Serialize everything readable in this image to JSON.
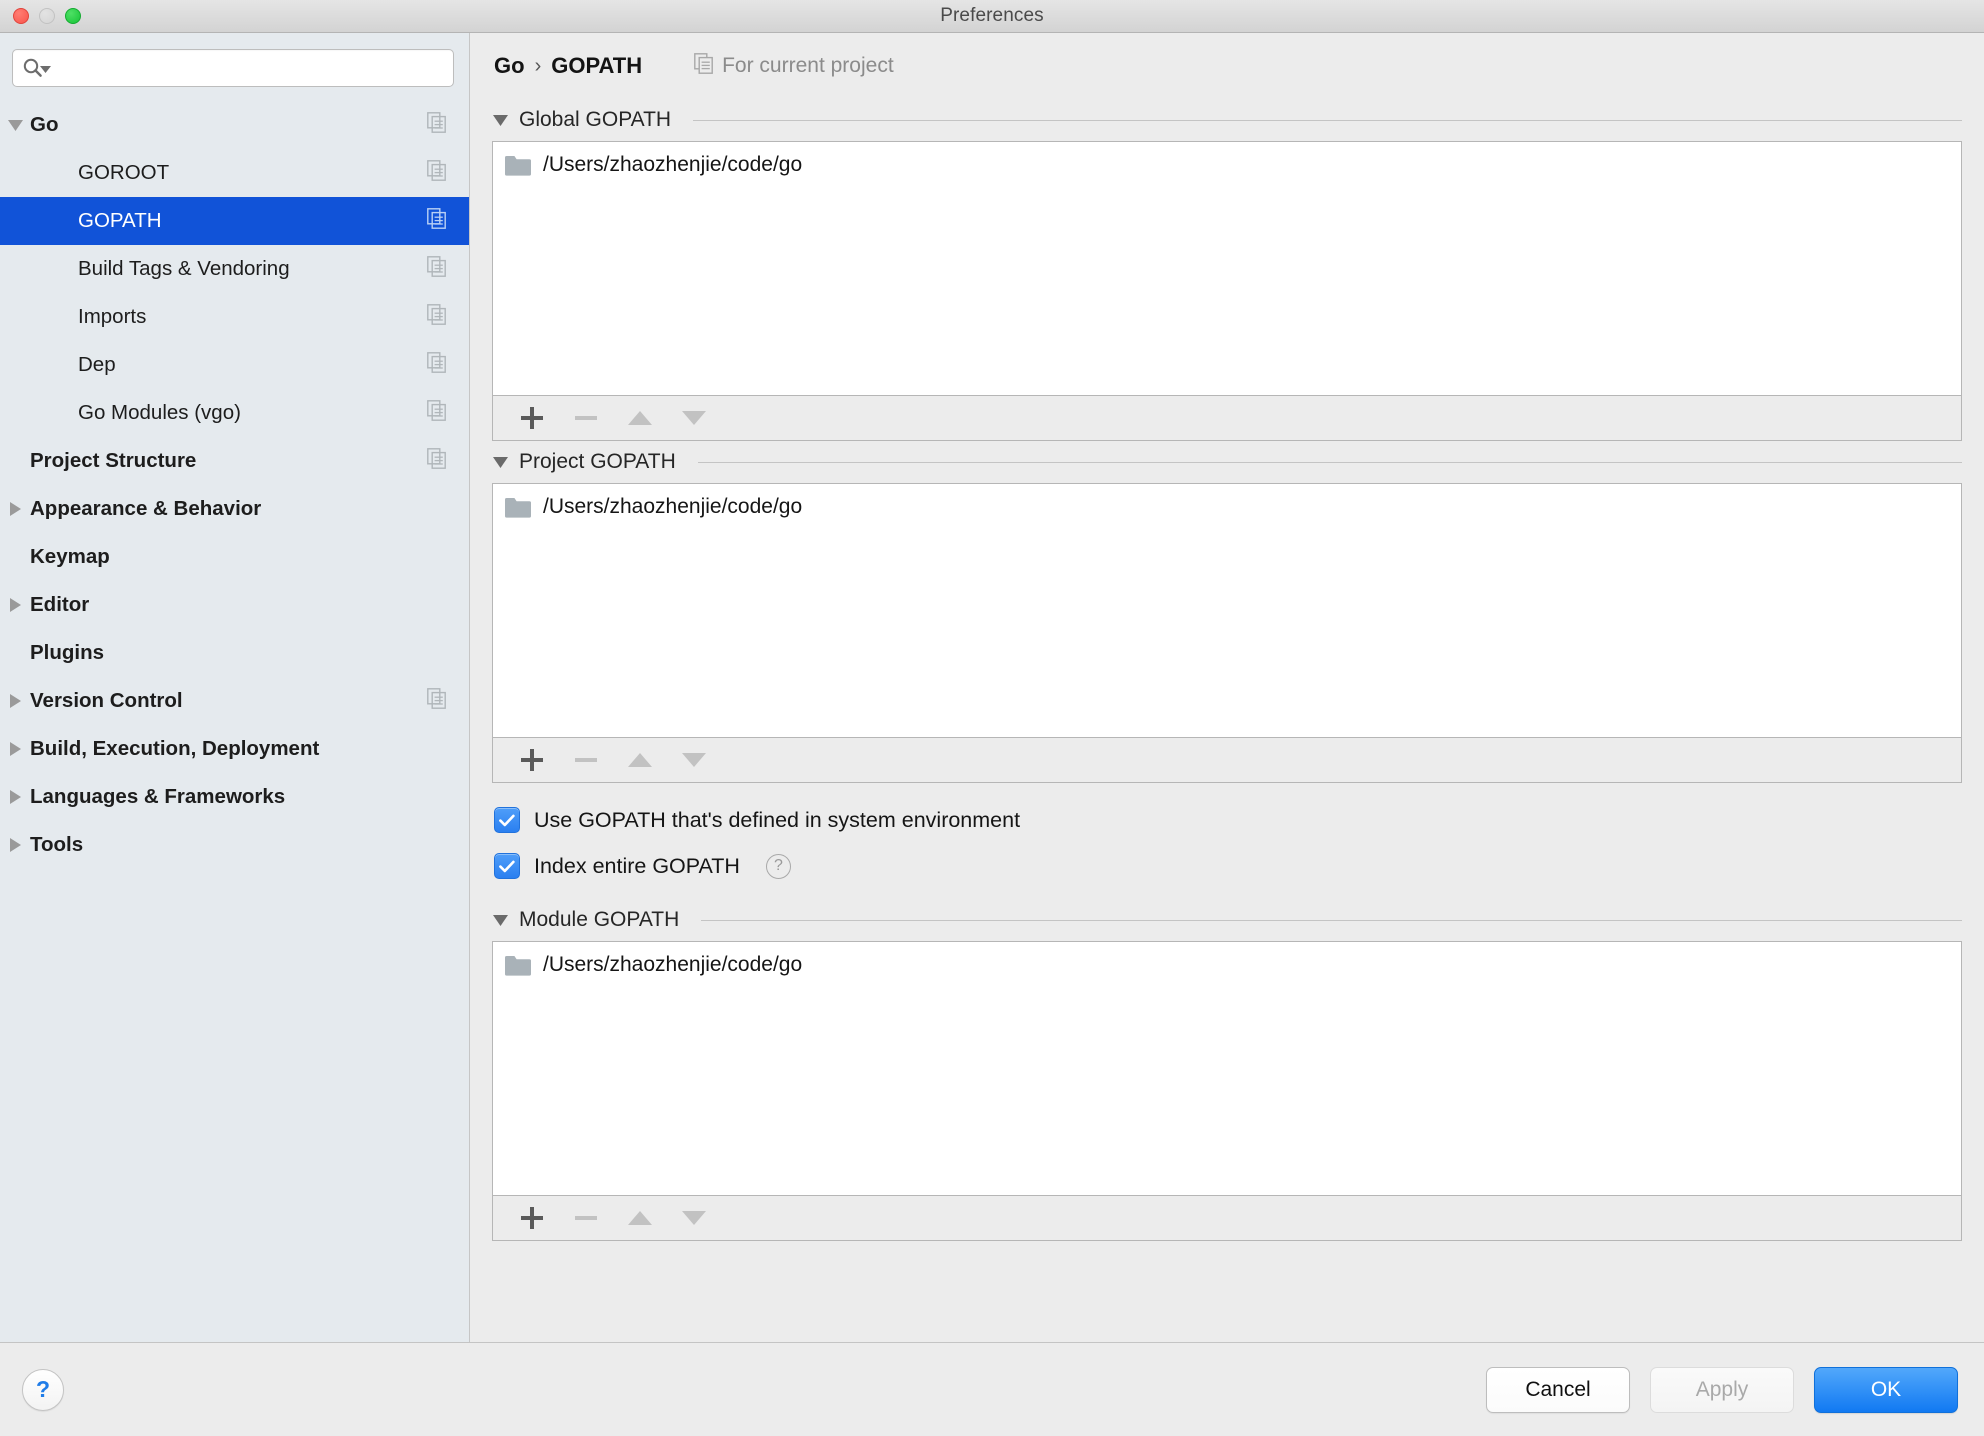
{
  "window": {
    "title": "Preferences",
    "traffic_lights": [
      "close-red",
      "minimize-disabled",
      "zoom-green"
    ]
  },
  "search": {
    "value": "",
    "placeholder": "",
    "icon": "search-icon"
  },
  "sidebar": {
    "items": [
      {
        "label": "Go",
        "level": "top",
        "twisty": "expanded",
        "copy": true
      },
      {
        "label": "GOROOT",
        "level": "child",
        "twisty": "none",
        "copy": true
      },
      {
        "label": "GOPATH",
        "level": "child",
        "twisty": "none",
        "copy": true,
        "selected": true
      },
      {
        "label": "Build Tags & Vendoring",
        "level": "child",
        "twisty": "none",
        "copy": true
      },
      {
        "label": "Imports",
        "level": "child",
        "twisty": "none",
        "copy": true
      },
      {
        "label": "Dep",
        "level": "child",
        "twisty": "none",
        "copy": true
      },
      {
        "label": "Go Modules (vgo)",
        "level": "child",
        "twisty": "none",
        "copy": true
      },
      {
        "label": "Project Structure",
        "level": "top",
        "twisty": "none",
        "copy": true
      },
      {
        "label": "Appearance & Behavior",
        "level": "top",
        "twisty": "collapsed",
        "copy": false
      },
      {
        "label": "Keymap",
        "level": "top",
        "twisty": "none",
        "copy": false
      },
      {
        "label": "Editor",
        "level": "top",
        "twisty": "collapsed",
        "copy": false
      },
      {
        "label": "Plugins",
        "level": "top",
        "twisty": "none",
        "copy": false
      },
      {
        "label": "Version Control",
        "level": "top",
        "twisty": "collapsed",
        "copy": true
      },
      {
        "label": "Build, Execution, Deployment",
        "level": "top",
        "twisty": "collapsed",
        "copy": false
      },
      {
        "label": "Languages & Frameworks",
        "level": "top",
        "twisty": "collapsed",
        "copy": false
      },
      {
        "label": "Tools",
        "level": "top",
        "twisty": "collapsed",
        "copy": false
      }
    ]
  },
  "header": {
    "breadcrumb": [
      "Go",
      "GOPATH"
    ],
    "separator": "›",
    "scope_label": "For current project",
    "scope_icon": "copy-icon"
  },
  "sections": [
    {
      "title": "Global GOPATH",
      "collapsed": false,
      "items": [
        {
          "icon": "folder-icon",
          "path": "/Users/zhaozhenjie/code/go"
        }
      ],
      "toolbar": [
        {
          "name": "add-button",
          "glyph": "+",
          "enabled": true
        },
        {
          "name": "remove-button",
          "glyph": "−",
          "enabled": false
        },
        {
          "name": "move-up-button",
          "glyph": "▲",
          "enabled": false
        },
        {
          "name": "move-down-button",
          "glyph": "▼",
          "enabled": false
        }
      ]
    },
    {
      "title": "Project GOPATH",
      "collapsed": false,
      "items": [
        {
          "icon": "folder-icon",
          "path": "/Users/zhaozhenjie/code/go"
        }
      ],
      "toolbar": [
        {
          "name": "add-button",
          "glyph": "+",
          "enabled": true
        },
        {
          "name": "remove-button",
          "glyph": "−",
          "enabled": false
        },
        {
          "name": "move-up-button",
          "glyph": "▲",
          "enabled": false
        },
        {
          "name": "move-down-button",
          "glyph": "▼",
          "enabled": false
        }
      ]
    },
    {
      "title": "Module GOPATH",
      "collapsed": false,
      "items": [
        {
          "icon": "folder-icon",
          "path": "/Users/zhaozhenjie/code/go"
        }
      ],
      "toolbar": [
        {
          "name": "add-button",
          "glyph": "+",
          "enabled": true
        },
        {
          "name": "remove-button",
          "glyph": "−",
          "enabled": false
        },
        {
          "name": "move-up-button",
          "glyph": "▲",
          "enabled": false
        },
        {
          "name": "move-down-button",
          "glyph": "▼",
          "enabled": false
        }
      ]
    }
  ],
  "checkboxes": [
    {
      "label": "Use GOPATH that's defined in system environment",
      "checked": true,
      "help": false
    },
    {
      "label": "Index entire GOPATH",
      "checked": true,
      "help": true,
      "help_glyph": "?"
    }
  ],
  "footer": {
    "help_glyph": "?",
    "cancel_label": "Cancel",
    "apply_label": "Apply",
    "ok_label": "OK",
    "apply_enabled": false
  },
  "colors": {
    "selection_blue": "#1153d8",
    "accent_blue": "#2a7ff0",
    "sidebar_bg": "#e5eaee",
    "main_bg": "#ececec",
    "list_bg": "#ffffff",
    "folder_gray": "#a9b2b8"
  }
}
